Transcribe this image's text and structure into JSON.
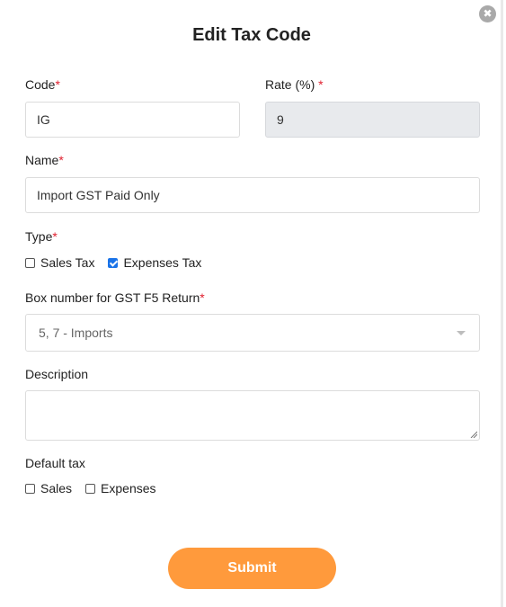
{
  "modal": {
    "title": "Edit Tax Code",
    "close_glyph": "✖"
  },
  "form": {
    "code": {
      "label": "Code",
      "required_mark": "*",
      "value": "IG"
    },
    "rate": {
      "label": "Rate (%)",
      "required_mark": "*",
      "value": "9"
    },
    "name": {
      "label": "Name",
      "required_mark": "*",
      "value": "Import GST Paid Only"
    },
    "type": {
      "label": "Type",
      "required_mark": "*",
      "options": [
        {
          "label": "Sales Tax",
          "checked": false
        },
        {
          "label": "Expenses Tax",
          "checked": true
        }
      ]
    },
    "box_number": {
      "label": "Box number for GST F5 Return",
      "required_mark": "*",
      "selected": "5, 7 - Imports"
    },
    "description": {
      "label": "Description",
      "value": ""
    },
    "default_tax": {
      "label": "Default tax",
      "options": [
        {
          "label": "Sales",
          "checked": false
        },
        {
          "label": "Expenses",
          "checked": false
        }
      ]
    }
  },
  "submit_label": "Submit",
  "colors": {
    "accent": "#ff9a3c",
    "required": "#e0202f",
    "checkbox_checked": "#1a73e8",
    "readonly_bg": "#e8eaed"
  }
}
